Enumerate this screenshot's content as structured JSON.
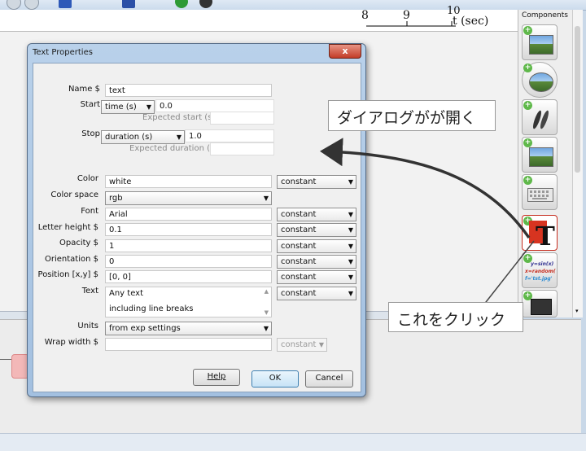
{
  "window": {
    "components_title": "Components",
    "timeline_ticks": [
      "8",
      "9",
      "10"
    ],
    "timeline_unit": "t (sec)"
  },
  "dialog": {
    "title": "Text Properties",
    "close_symbol": "x",
    "name": {
      "label": "Name $",
      "value": "text"
    },
    "start": {
      "label": "Start",
      "type": "time (s)",
      "value": "0.0",
      "expected_label": "Expected start (s)"
    },
    "stop": {
      "label": "Stop",
      "type": "duration (s)",
      "value": "1.0",
      "expected_label": "Expected duration (s)"
    },
    "color": {
      "label": "Color",
      "value": "white",
      "update": "constant"
    },
    "color_space": {
      "label": "Color space",
      "value": "rgb"
    },
    "font": {
      "label": "Font",
      "value": "Arial",
      "update": "constant"
    },
    "letter_height": {
      "label": "Letter height $",
      "value": "0.1",
      "update": "constant"
    },
    "opacity": {
      "label": "Opacity $",
      "value": "1",
      "update": "constant"
    },
    "orientation": {
      "label": "Orientation $",
      "value": "0",
      "update": "constant"
    },
    "position": {
      "label": "Position [x,y] $",
      "value": "[0, 0]",
      "update": "constant"
    },
    "text": {
      "label": "Text",
      "line1": "Any text",
      "line2": "including line breaks",
      "update": "constant"
    },
    "units": {
      "label": "Units",
      "value": "from exp settings"
    },
    "wrap_width": {
      "label": "Wrap width $",
      "value": "",
      "update": "constant"
    },
    "buttons": {
      "help": "Help",
      "ok": "OK",
      "cancel": "Cancel"
    }
  },
  "annotations": {
    "dialog_opens": "ダイアログがが開く",
    "click_this": "これをクリック"
  },
  "components": [
    {
      "icon": "image-icon"
    },
    {
      "icon": "movie-icon"
    },
    {
      "icon": "grating-icon"
    },
    {
      "icon": "patch-icon"
    },
    {
      "icon": "keyboard-icon"
    },
    {
      "icon": "text-icon"
    },
    {
      "icon": "code-icon",
      "snippet1": "y=sin(x)",
      "snippet2": "x=random(",
      "snippet3": "f='tst.jpg'"
    },
    {
      "icon": "film-icon"
    }
  ],
  "colors": {
    "accent_red": "#c62d1f",
    "arrow": "#333333"
  }
}
